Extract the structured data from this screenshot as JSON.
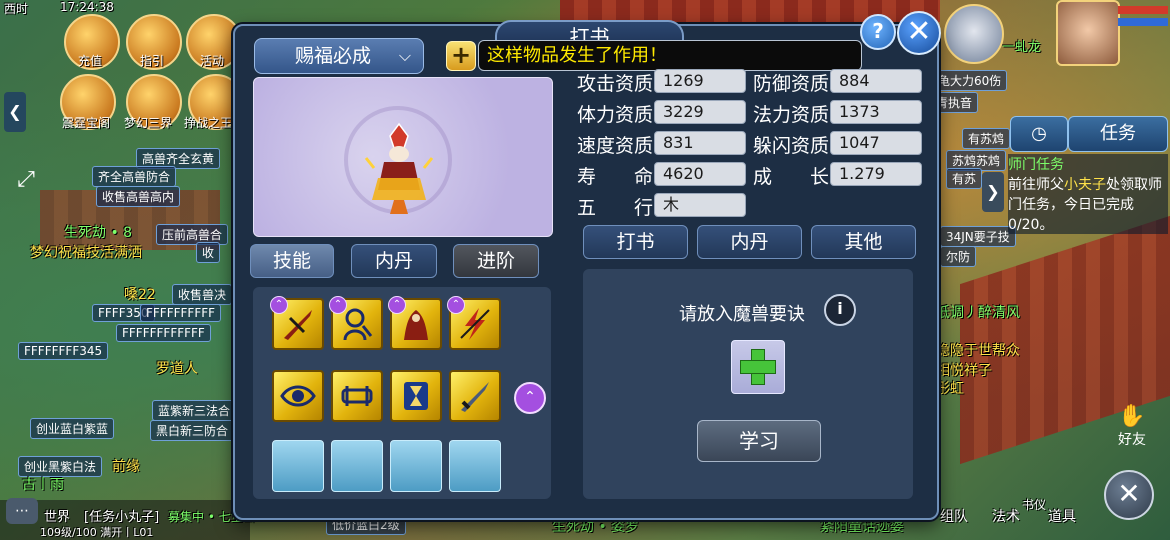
{
  "scene": {
    "clock": "17:24:38",
    "server_tag": "西时",
    "top_icons": [
      "充值",
      "指引",
      "活动",
      "震霆宝阁",
      "梦幻三界",
      "挣战之王"
    ],
    "left_labels": [
      "高兽齐全玄黄",
      "齐全高兽防合",
      "收售高兽高内",
      "生死劫 • 8",
      "压前高兽合",
      "梦幻祝福技活满洒",
      "收",
      "嗓22",
      "收售兽决",
      "FFFF350",
      "FFFFFFFFFF",
      "FFFFFFFFFFFF",
      "FFFFFFFF345",
      "罗道人",
      "蓝紫新三法合",
      "黑白新三防合",
      "创业蓝白紫蓝",
      "创业黑紫白法",
      "前缘",
      "古丨雨"
    ],
    "right_labels": [
      "龙龟大力60伤",
      "青执音",
      "有苏鸩",
      "苏鸩苏鸩",
      "有苏",
      "34JN要子技",
      "尔防",
      "低调丿醉清风",
      "隐隐于世帮众",
      "相悦祥子",
      "彤虹",
      "一虬龙"
    ],
    "bottom_labels": [
      "世界",
      "[任务小丸子]",
      "募集中 • 七宝山",
      "低价蓝白2级",
      "生死劫 • 姿罗",
      "紧阳童话迹婆"
    ],
    "chat_meta": "109级/100 满开丨L01",
    "hud": {
      "task_label": "任务",
      "quest_title": "师门任务",
      "quest_text_1": "前往师父",
      "quest_npc": "小夫子",
      "quest_text_2": "处领取师门任务，今日已完成0/20。",
      "friends_label": "好友",
      "team_label": "组队",
      "spell_label": "法术",
      "items_label": "道具",
      "book_label": "书仪"
    }
  },
  "dialog": {
    "title": "打书",
    "pet_name": "赐福必成",
    "toast": "这样物品发生了作用！",
    "pet_tabs": [
      "技能",
      "内丹",
      "进阶"
    ],
    "active_pet_tab": "技能",
    "stats": [
      {
        "label": "攻击资质",
        "value": "1269"
      },
      {
        "label": "防御资质",
        "value": "884"
      },
      {
        "label": "体力资质",
        "value": "3229"
      },
      {
        "label": "法力资质",
        "value": "1373"
      },
      {
        "label": "速度资质",
        "value": "831"
      },
      {
        "label": "躲闪资质",
        "value": "1047"
      },
      {
        "label": "寿　　命",
        "value": "4620"
      },
      {
        "label": "成　　长",
        "value": "1.279"
      },
      {
        "label": "五　　行",
        "value": "木"
      }
    ],
    "right_tabs": [
      "打书",
      "内丹",
      "其他"
    ],
    "book_prompt": "请放入魔兽要诀",
    "learn_button": "学习",
    "skills": [
      "sword-strike-icon",
      "mind-control-icon",
      "cloaked-figure-icon",
      "lightning-icon",
      "eye-icon",
      "shield-bar-icon",
      "hourglass-icon",
      "blade-icon"
    ],
    "empty_slots": 4,
    "colors": {
      "toast_text": "#ffea00",
      "panel": "#1d2e44",
      "skill_gold": "#e2b40d",
      "plus_green": "#46c43a"
    }
  }
}
